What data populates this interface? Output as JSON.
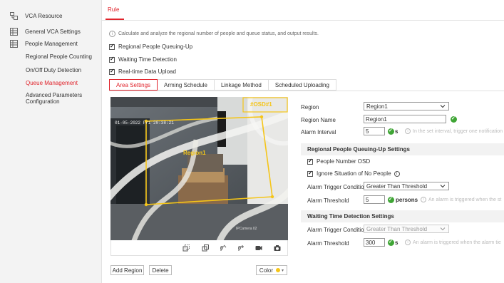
{
  "sidebar": {
    "items": [
      {
        "label": "VCA Resource",
        "icon": "vca-resource-icon"
      },
      {
        "label": "General VCA Settings",
        "icon": "settings-grid-icon"
      },
      {
        "label": "People Management",
        "icon": "people-management-icon"
      }
    ],
    "sub_items": [
      {
        "label": "Regional People Counting",
        "active": false
      },
      {
        "label": "On/Off Duty Detection",
        "active": false
      },
      {
        "label": "Queue Management",
        "active": true
      },
      {
        "label": "Advanced Parameters",
        "label2": "Configuration",
        "active": false
      }
    ]
  },
  "main": {
    "tab": "Rule",
    "info_text": "Calculate and analyze the regional number of people and queue status, and output results.",
    "checkboxes": [
      {
        "label": "Regional People Queuing-Up",
        "checked": true
      },
      {
        "label": "Waiting Time Detection",
        "checked": true
      },
      {
        "label": "Real-time Data Upload",
        "checked": true
      }
    ],
    "subtabs": [
      "Area Settings",
      "Arming Schedule",
      "Linkage Method",
      "Scheduled Uploading"
    ],
    "active_subtab": "Area Settings"
  },
  "video": {
    "timestamp": "01-05-2022 Fri 20:38:21",
    "osd_label": "#OSD#1",
    "region_label": "Region1",
    "channel_label": "IPCamera 02",
    "accent": "#f5c518"
  },
  "buttons": {
    "add_region": "Add Region",
    "delete": "Delete",
    "color": "Color",
    "color_swatch": "#f5c518"
  },
  "form": {
    "region_label": "Region",
    "region_value": "Region1",
    "region_name_label": "Region Name",
    "region_name_value": "Region1",
    "alarm_interval_label": "Alarm Interval",
    "alarm_interval_value": "5",
    "alarm_interval_unit": "s",
    "alarm_interval_hint": "In the set interval, trigger one notification",
    "queue_section": "Regional People Queuing-Up Settings",
    "people_osd": "People Number OSD",
    "ignore_no_people": "Ignore Situation of No People",
    "queue_trigger_label": "Alarm Trigger Condition",
    "queue_trigger_value": "Greater Than Threshold",
    "queue_threshold_label": "Alarm Threshold",
    "queue_threshold_value": "5",
    "queue_threshold_unit": "persons",
    "queue_threshold_hint": "An alarm is triggered when the st",
    "wait_section": "Waiting Time Detection Settings",
    "wait_trigger_label": "Alarm Trigger Condition",
    "wait_trigger_value": "Greater Than Threshold",
    "wait_threshold_label": "Alarm Threshold",
    "wait_threshold_value": "300",
    "wait_threshold_unit": "s",
    "wait_threshold_hint": "An alarm is triggered when the alarm tie"
  },
  "colors": {
    "accent": "#e0232b",
    "ok": "#3fa535",
    "polygon": "#f5c518"
  }
}
